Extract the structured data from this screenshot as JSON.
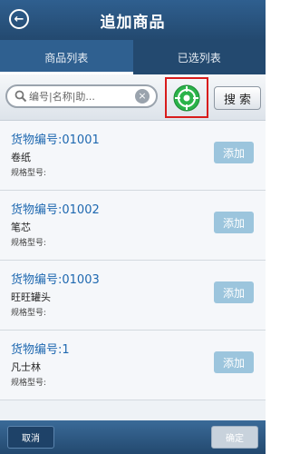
{
  "header": {
    "title": "追加商品",
    "back_icon": "back-arrow-circle-icon"
  },
  "tabs": [
    {
      "label": "商品列表",
      "active": true
    },
    {
      "label": "已选列表",
      "active": false
    }
  ],
  "search": {
    "placeholder": "编号|名称|助...",
    "value": "",
    "button_label": "搜索",
    "scan_icon": "crosshair-scan-icon",
    "scan_highlight_color": "#d81c1c"
  },
  "items": [
    {
      "code": "货物编号:01001",
      "name": "卷纸",
      "spec": "规格型号:",
      "add_label": "添加"
    },
    {
      "code": "货物编号:01002",
      "name": "笔芯",
      "spec": "规格型号:",
      "add_label": "添加"
    },
    {
      "code": "货物编号:01003",
      "name": "旺旺罐头",
      "spec": "规格型号:",
      "add_label": "添加"
    },
    {
      "code": "货物编号:1",
      "name": "凡士林",
      "spec": "规格型号:",
      "add_label": "添加"
    }
  ],
  "footer": {
    "cancel_label": "取消",
    "confirm_label": "确定"
  },
  "colors": {
    "header": "#2f5f8f",
    "accent": "#1e68b0",
    "add_button": "#9cc5dd",
    "scan_green": "#2bb34a"
  }
}
